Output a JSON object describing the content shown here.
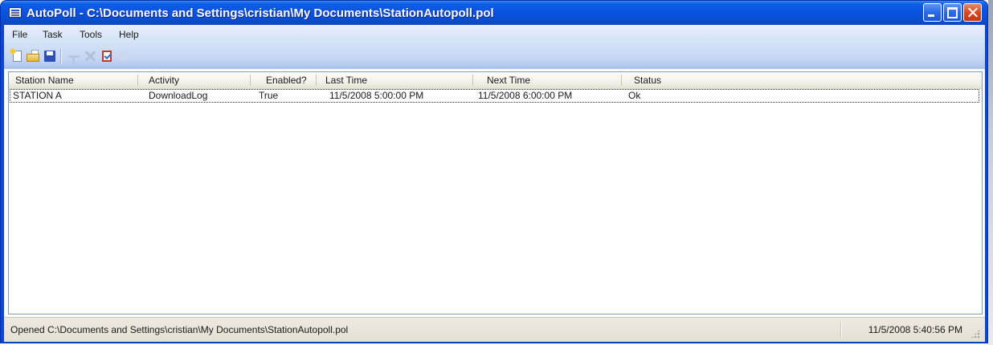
{
  "window": {
    "title": "AutoPoll - C:\\Documents and Settings\\cristian\\My Documents\\StationAutopoll.pol"
  },
  "menu": {
    "items": [
      "File",
      "Task",
      "Tools",
      "Help"
    ]
  },
  "toolbar": {
    "icons": [
      "new-document-icon",
      "open-folder-icon",
      "save-disk-icon",
      "properties-icon",
      "delete-icon",
      "task-icon",
      "run-icon"
    ]
  },
  "list": {
    "columns": [
      "Station Name",
      "Activity",
      "Enabled?",
      "Last Time",
      "Next Time",
      "Status"
    ],
    "rows": [
      {
        "station_name": "STATION A",
        "activity": "DownloadLog",
        "enabled": "True",
        "last_time": "11/5/2008 5:00:00 PM",
        "next_time": "11/5/2008 6:00:00 PM",
        "status": "Ok"
      }
    ]
  },
  "statusbar": {
    "message": "Opened C:\\Documents and Settings\\cristian\\My Documents\\StationAutopoll.pol",
    "time": "11/5/2008 5:40:56 PM"
  },
  "colors": {
    "titlebar": "#0a53df",
    "menubar": "#d3e1f7",
    "close_button": "#d64a22"
  }
}
